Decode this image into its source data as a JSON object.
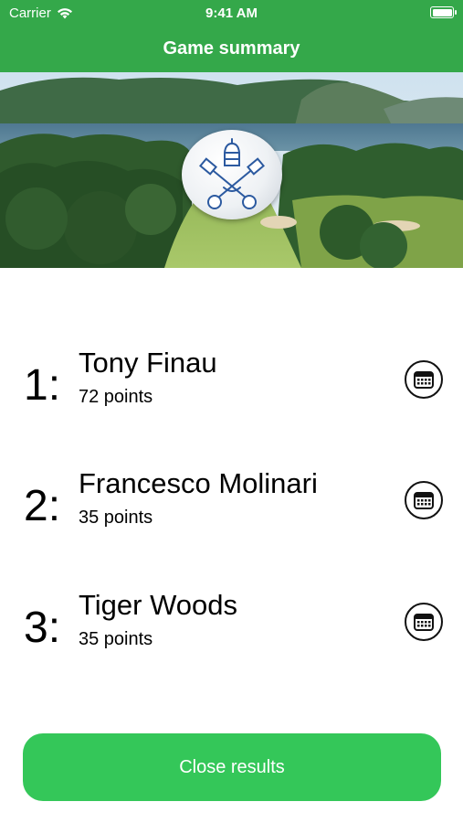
{
  "status_bar": {
    "carrier": "Carrier",
    "time": "9:41 AM"
  },
  "nav": {
    "title": "Game summary"
  },
  "hero": {
    "image": "golf-course-lake-landscape",
    "logo": "crossed-keys-tiara-crest-on-golf-ball"
  },
  "results": [
    {
      "rank": "1:",
      "name": "Tony Finau",
      "points": "72 points"
    },
    {
      "rank": "2:",
      "name": "Francesco Molinari",
      "points": "35 points"
    },
    {
      "rank": "3:",
      "name": "Tiger Woods",
      "points": "35 points"
    }
  ],
  "scorecard_icon": "calendar-icon",
  "close_button": {
    "label": "Close results"
  },
  "colors": {
    "nav_green": "#34a84a",
    "button_green": "#34c759"
  }
}
